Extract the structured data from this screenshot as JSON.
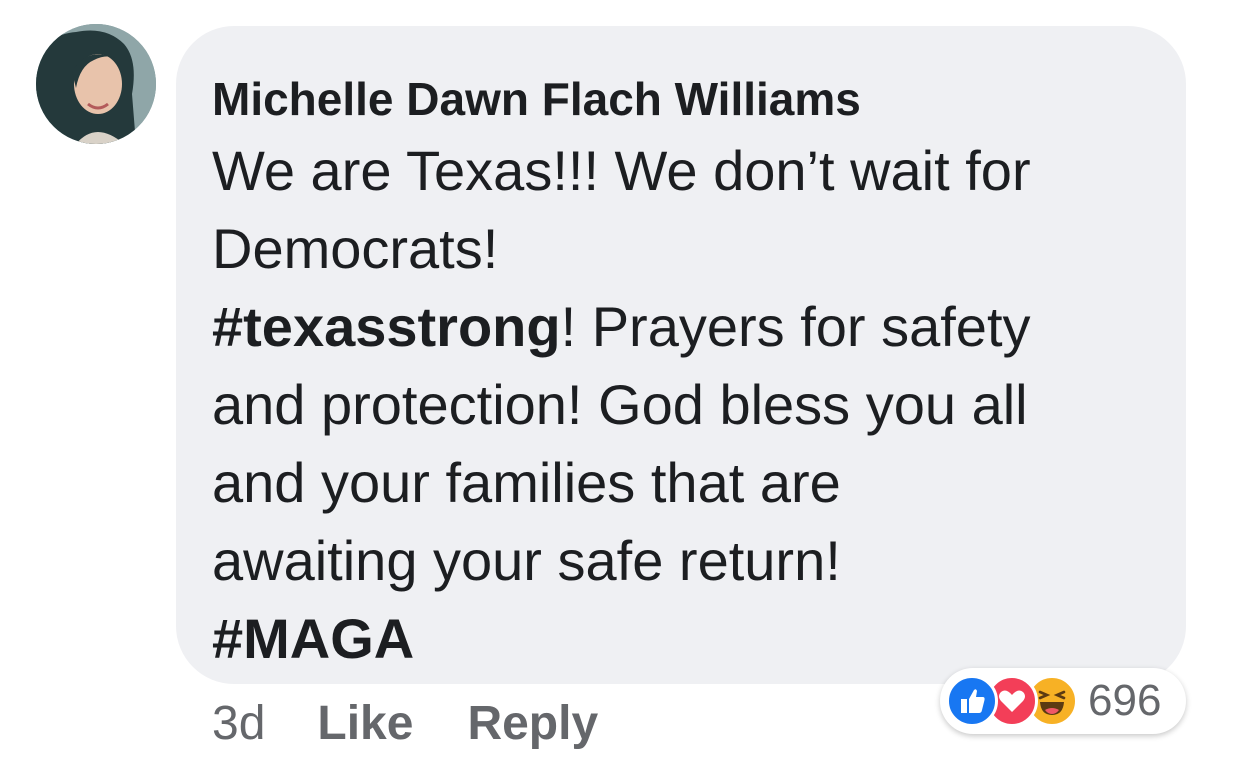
{
  "comment": {
    "author": "Michelle Dawn Flach Williams",
    "lines": [
      {
        "text": "We are Texas!!!  We don’t wait for"
      },
      {
        "text": "Democrats!"
      },
      {
        "hashtag": "#texasstrong",
        "text": "!  Prayers for safety"
      },
      {
        "text": "and protection!  God bless you all"
      },
      {
        "text": "and your families that are"
      },
      {
        "text": "awaiting your safe return!"
      },
      {
        "hashtag": "#MAGA",
        "text": ""
      }
    ]
  },
  "actions": {
    "time": "3d",
    "like_label": "Like",
    "reply_label": "Reply"
  },
  "reactions": {
    "icons": [
      "like-icon",
      "love-icon",
      "haha-icon"
    ],
    "count": "696",
    "colors": {
      "like": "#1877f2",
      "love": "#f33e58",
      "haha": "#f7b125"
    }
  }
}
